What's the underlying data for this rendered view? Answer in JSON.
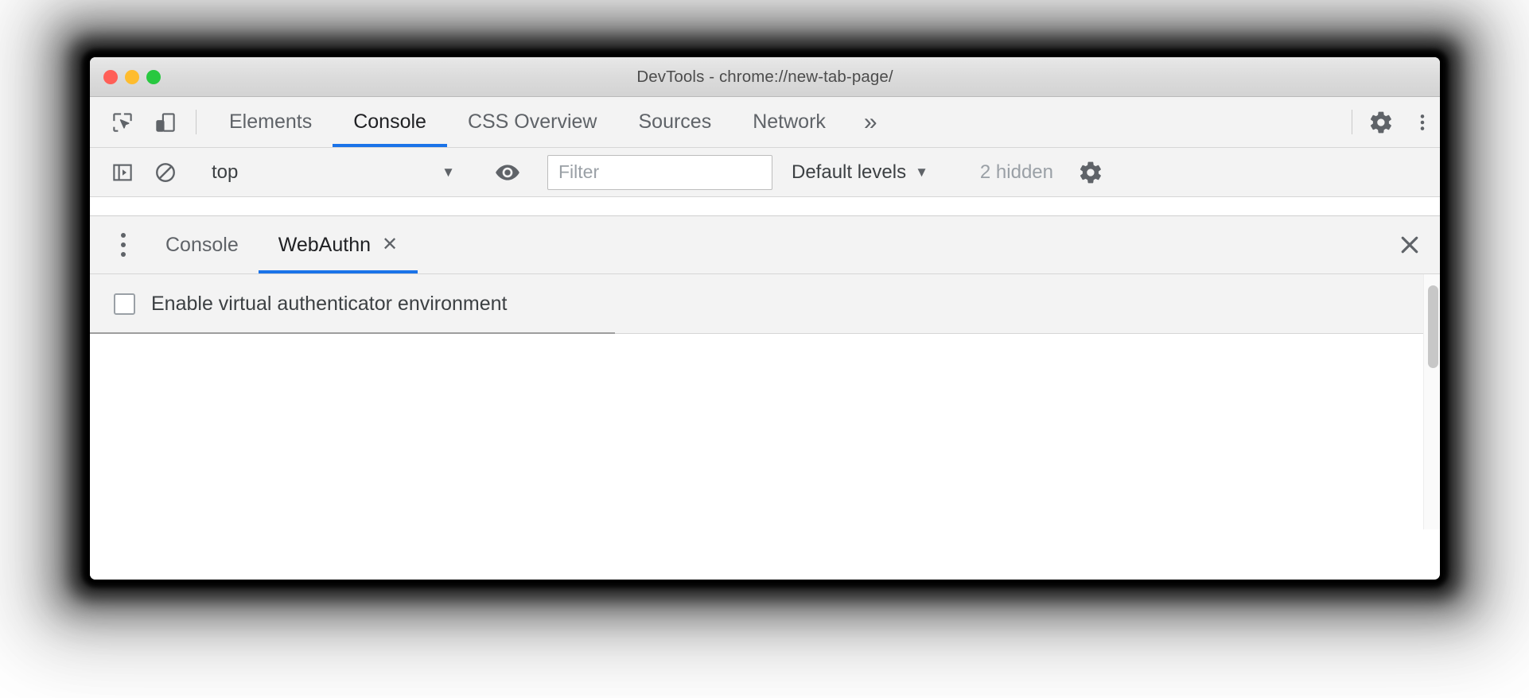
{
  "window": {
    "title": "DevTools - chrome://new-tab-page/",
    "traffic_lights": [
      {
        "name": "close",
        "color": "#ff5f57"
      },
      {
        "name": "minimize",
        "color": "#febc2e"
      },
      {
        "name": "zoom",
        "color": "#28c840"
      }
    ]
  },
  "toolbar": {
    "inspect_icon": "inspect-element-icon",
    "device_icon": "device-toolbar-icon",
    "settings_icon": "gear-icon",
    "more_icon": "vertical-dots-icon"
  },
  "main_tabs": {
    "items": [
      {
        "label": "Elements",
        "active": false
      },
      {
        "label": "Console",
        "active": true
      },
      {
        "label": "CSS Overview",
        "active": false
      },
      {
        "label": "Sources",
        "active": false
      },
      {
        "label": "Network",
        "active": false
      }
    ],
    "overflow_label": "»",
    "active_underline_color": "#1a73e8"
  },
  "console_toolbar": {
    "sidebar_toggle_icon": "console-sidebar-icon",
    "clear_icon": "clear-console-icon",
    "context_value": "top",
    "context_caret": "▼",
    "eye_icon": "live-expression-eye-icon",
    "filter_placeholder": "Filter",
    "filter_value": "",
    "levels_label": "Default levels",
    "levels_caret": "▼",
    "hidden_count": "2 hidden",
    "settings_icon": "console-settings-gear-icon"
  },
  "drawer": {
    "menu_icon": "drawer-more-options-icon",
    "tabs": [
      {
        "label": "Console",
        "active": false,
        "closable": false
      },
      {
        "label": "WebAuthn",
        "active": true,
        "closable": true
      }
    ],
    "tab_close_glyph": "✕",
    "close_glyph": "✕",
    "active_underline_color": "#1a73e8"
  },
  "webauthn": {
    "enable_checkbox_label": "Enable virtual authenticator environment",
    "enable_checkbox_checked": false
  }
}
